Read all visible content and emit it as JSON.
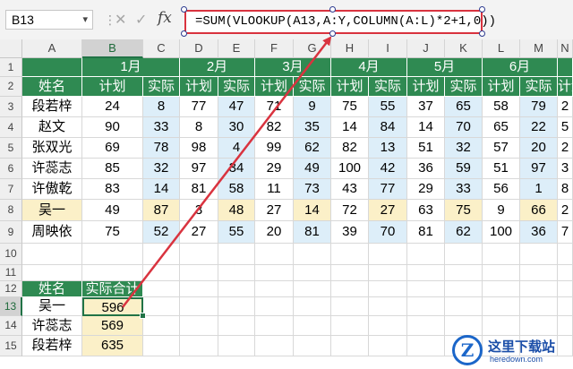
{
  "formula_bar": {
    "name_box": "B13",
    "formula": "=SUM(VLOOKUP(A13,A:Y,COLUMN(A:L)*2+1,0))",
    "fx_label": "fx"
  },
  "columns": [
    "A",
    "B",
    "C",
    "D",
    "E",
    "F",
    "G",
    "H",
    "I",
    "J",
    "K",
    "L",
    "M",
    "N"
  ],
  "rows": [
    "1",
    "2",
    "3",
    "4",
    "5",
    "6",
    "7",
    "8",
    "9",
    "10",
    "11",
    "12",
    "13",
    "14",
    "15"
  ],
  "months": [
    "1月",
    "2月",
    "3月",
    "4月",
    "5月",
    "6月"
  ],
  "sub_headers": [
    "计划",
    "实际"
  ],
  "name_header": "姓名",
  "table_rows": [
    {
      "name": "段若梓",
      "values": [
        "24",
        "8",
        "77",
        "47",
        "71",
        "9",
        "75",
        "55",
        "37",
        "65",
        "58",
        "79",
        "2"
      ]
    },
    {
      "name": "赵文",
      "values": [
        "90",
        "33",
        "8",
        "30",
        "82",
        "35",
        "14",
        "84",
        "14",
        "70",
        "65",
        "22",
        "5"
      ]
    },
    {
      "name": "张双光",
      "values": [
        "69",
        "78",
        "98",
        "4",
        "99",
        "62",
        "82",
        "13",
        "51",
        "32",
        "57",
        "20",
        "2"
      ]
    },
    {
      "name": "许蕊志",
      "values": [
        "85",
        "32",
        "97",
        "34",
        "29",
        "49",
        "100",
        "42",
        "36",
        "59",
        "51",
        "97",
        "3"
      ]
    },
    {
      "name": "许傲乾",
      "values": [
        "83",
        "14",
        "81",
        "58",
        "11",
        "73",
        "43",
        "77",
        "29",
        "33",
        "56",
        "1",
        "8"
      ]
    },
    {
      "name": "吴一",
      "values": [
        "49",
        "87",
        "3",
        "48",
        "27",
        "14",
        "72",
        "27",
        "63",
        "75",
        "9",
        "66",
        "2"
      ]
    },
    {
      "name": "周映依",
      "values": [
        "75",
        "52",
        "27",
        "55",
        "20",
        "81",
        "39",
        "70",
        "81",
        "62",
        "100",
        "36",
        "7"
      ]
    }
  ],
  "lookup": {
    "header_name": "姓名",
    "header_total": "实际合计",
    "rows": [
      {
        "name": "吴一",
        "total": "596"
      },
      {
        "name": "许蕊志",
        "total": "569"
      },
      {
        "name": "段若梓",
        "total": "635"
      }
    ]
  },
  "watermark": {
    "badge": "Z",
    "title": "这里下载站",
    "url": "heredown.com"
  },
  "colors": {
    "header_green": "#2f8a52",
    "highlight_blue": "#ddeef9",
    "highlight_yellow": "#fbf0c8",
    "arrow_red": "#d9333f"
  }
}
